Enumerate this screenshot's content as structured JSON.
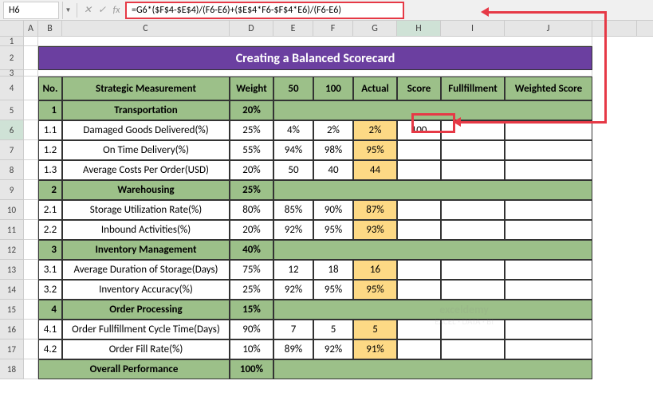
{
  "formula_bar": {
    "cell_ref": "H6",
    "formula": "=G6*($F$4-$E$4)/(F6-E6)+($E$4*F6-$F$4*E6)/(F6-E6)"
  },
  "cols": [
    "A",
    "B",
    "C",
    "D",
    "E",
    "F",
    "G",
    "H",
    "I",
    "J"
  ],
  "title": "Creating a Balanced Scorecard",
  "headers": {
    "no": "No.",
    "sm": "Strategic Measurement",
    "w": "Weight",
    "c50": "50",
    "c100": "100",
    "act": "Actual",
    "sc": "Score",
    "ful": "Fullfillment",
    "ws": "Weighted Score"
  },
  "sections": [
    {
      "no": "1",
      "name": "Transportation",
      "w": "20%"
    },
    {
      "no": "2",
      "name": "Warehousing",
      "w": "25%"
    },
    {
      "no": "3",
      "name": "Inventory Management",
      "w": "40%"
    },
    {
      "no": "4",
      "name": "Order Processing",
      "w": "15%"
    }
  ],
  "rows": [
    {
      "no": "1.1",
      "name": "Damaged Goods Delivered(%)",
      "w": "25%",
      "c50": "4%",
      "c100": "2%",
      "act": "2%",
      "sc": "100"
    },
    {
      "no": "1.2",
      "name": "On Time Delivery(%)",
      "w": "55%",
      "c50": "94%",
      "c100": "98%",
      "act": "95%"
    },
    {
      "no": "1.3",
      "name": "Average Costs Per Order(USD)",
      "w": "20%",
      "c50": "50",
      "c100": "40",
      "act": "44"
    },
    {
      "no": "2.1",
      "name": "Storage Utilization Rate(%)",
      "w": "80%",
      "c50": "85%",
      "c100": "90%",
      "act": "87%"
    },
    {
      "no": "2.2",
      "name": "Inbound Activities(%)",
      "w": "20%",
      "c50": "92%",
      "c100": "95%",
      "act": "93%"
    },
    {
      "no": "3.1",
      "name": "Average Duration of Storage(Days)",
      "w": "75%",
      "c50": "12",
      "c100": "18",
      "act": "16"
    },
    {
      "no": "3.2",
      "name": "Inventory Accuracy(%)",
      "w": "25%",
      "c50": "92%",
      "c100": "95%",
      "act": "95%"
    },
    {
      "no": "4.1",
      "name": "Order Fullfillment Cycle Time(Days)",
      "w": "90%",
      "c50": "7",
      "c100": "5",
      "act": "5"
    },
    {
      "no": "4.2",
      "name": "Order Fill Rate(%)",
      "w": "10%",
      "c50": "89%",
      "c100": "92%",
      "act": "91%"
    }
  ],
  "overall": {
    "label": "Overall Performance",
    "w": "100%"
  },
  "row_nums": [
    "1",
    "2",
    "3",
    "4",
    "5",
    "6",
    "7",
    "8",
    "9",
    "10",
    "11",
    "12",
    "13",
    "14",
    "15",
    "16",
    "17",
    "18"
  ],
  "watermark": {
    "l1": "exceldemy",
    "l2": "EXCEL · DATA · BI"
  }
}
